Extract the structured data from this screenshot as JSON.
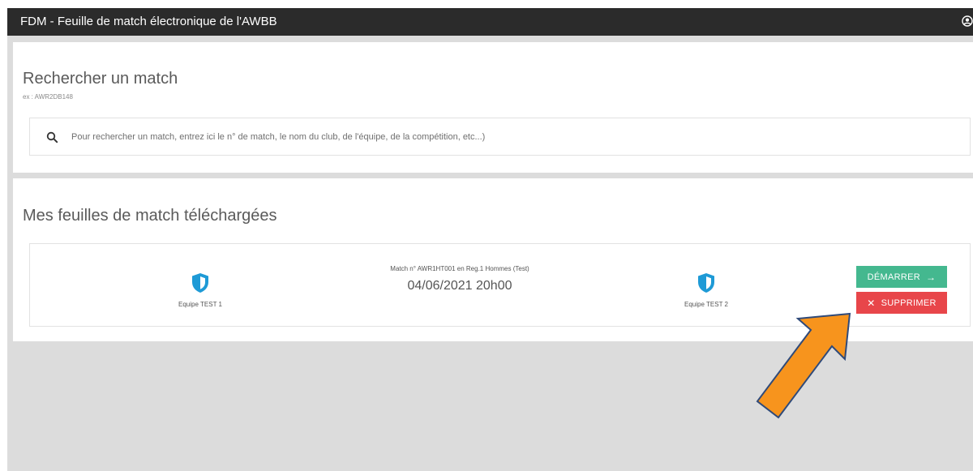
{
  "header": {
    "title": "FDM - Feuille de match électronique de l'AWBB",
    "user_icon": "user-circle-icon"
  },
  "search_section": {
    "title": "Rechercher un match",
    "hint": "ex : AWR2DB148",
    "search_icon": "search-icon",
    "placeholder": "Pour rechercher un match, entrez ici le n° de match, le nom du club, de l'équipe, de la compétition, etc...)"
  },
  "downloaded_section": {
    "title": "Mes feuilles de match téléchargées",
    "matches": [
      {
        "label": "Match n° AWR1HT001 en Reg.1 Hommes (Test)",
        "datetime": "04/06/2021 20h00",
        "home_team": "Equipe TEST 1",
        "away_team": "Equipe TEST 2",
        "team_icon": "shield-icon",
        "start_label": "DÉMARRER",
        "start_icon": "arrow-right-icon",
        "delete_label": "SUPPRIMER",
        "delete_icon": "close-icon"
      }
    ]
  },
  "colors": {
    "topbar": "#2b2b2b",
    "background": "#dcdcdc",
    "start_button": "#44b88f",
    "delete_button": "#e8464a",
    "shield": "#1e9ad6",
    "annotation_arrow": "#f7941d"
  },
  "annotation": {
    "type": "arrow",
    "points_to": "delete-button",
    "icon": "arrow-up-left-icon"
  }
}
